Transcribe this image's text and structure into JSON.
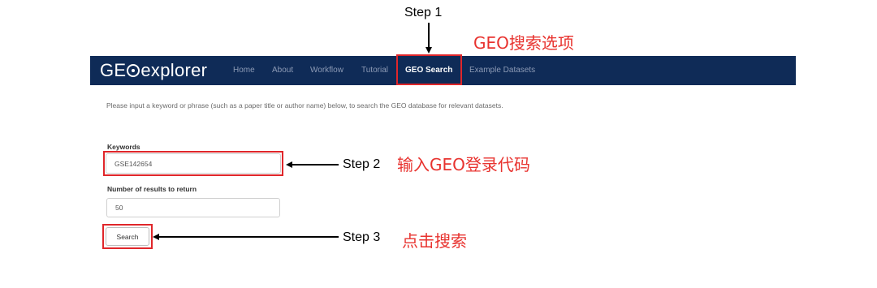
{
  "annotations": {
    "step1": "Step 1",
    "step1_note": "GEO搜索选项",
    "step2": "Step 2",
    "step2_note": "输入GEO登录代码",
    "step3": "Step 3",
    "step3_note": "点击搜索",
    "highlight_color": "#e0262a",
    "note_color": "#e8332f"
  },
  "navbar": {
    "brand_prefix": "GE",
    "brand_suffix": "explorer",
    "bg_color": "#0f2b57",
    "items": [
      {
        "label": "Home"
      },
      {
        "label": "About"
      },
      {
        "label": "Workflow"
      },
      {
        "label": "Tutorial"
      },
      {
        "label": "GEO Search",
        "active": true
      },
      {
        "label": "Example Datasets"
      }
    ]
  },
  "page": {
    "intro": "Please input a keyword or phrase (such as a paper title or author name) below, to search the GEO database for relevant datasets."
  },
  "form": {
    "keywords_label": "Keywords",
    "keywords_value": "GSE142654",
    "results_label": "Number of results to return",
    "results_value": "50",
    "search_button": "Search"
  }
}
